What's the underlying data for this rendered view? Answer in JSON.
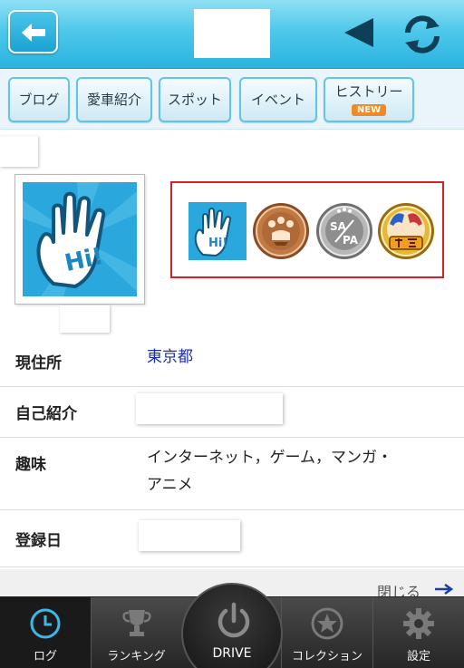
{
  "header": {
    "back_icon": "arrow-left-icon",
    "prev_icon": "triangle-left-icon",
    "refresh_icon": "refresh-icon",
    "accent": "#2ab3de"
  },
  "tabs": [
    {
      "label": "ブログ"
    },
    {
      "label": "愛車紹介"
    },
    {
      "label": "スポット"
    },
    {
      "label": "イベント"
    },
    {
      "label": "ヒストリー",
      "badge": "NEW"
    }
  ],
  "profile": {
    "avatar_text": "Hi!",
    "badges": [
      {
        "icon": "hi-hand-badge-icon"
      },
      {
        "icon": "bronze-medal-badge-icon"
      },
      {
        "icon": "sa-pa-badge-icon",
        "text": "SA PA"
      },
      {
        "icon": "anime-character-badge-icon"
      }
    ]
  },
  "info": [
    {
      "label": "現住所",
      "value": "東京都"
    },
    {
      "label": "自己紹介",
      "value": ""
    },
    {
      "label": "趣味",
      "value_line1": "インターネット，ゲーム，マンガ・",
      "value_line2": "アニメ"
    },
    {
      "label": "登録日",
      "value": ""
    }
  ],
  "close": {
    "label": "閉じる"
  },
  "bottom_nav": [
    {
      "label": "ログ",
      "icon": "clock-icon",
      "active": true
    },
    {
      "label": "ランキング",
      "icon": "trophy-icon"
    },
    {
      "label": "DRIVE",
      "icon": "power-icon"
    },
    {
      "label": "コレクション",
      "icon": "star-circle-icon"
    },
    {
      "label": "設定",
      "icon": "gear-icon"
    }
  ]
}
